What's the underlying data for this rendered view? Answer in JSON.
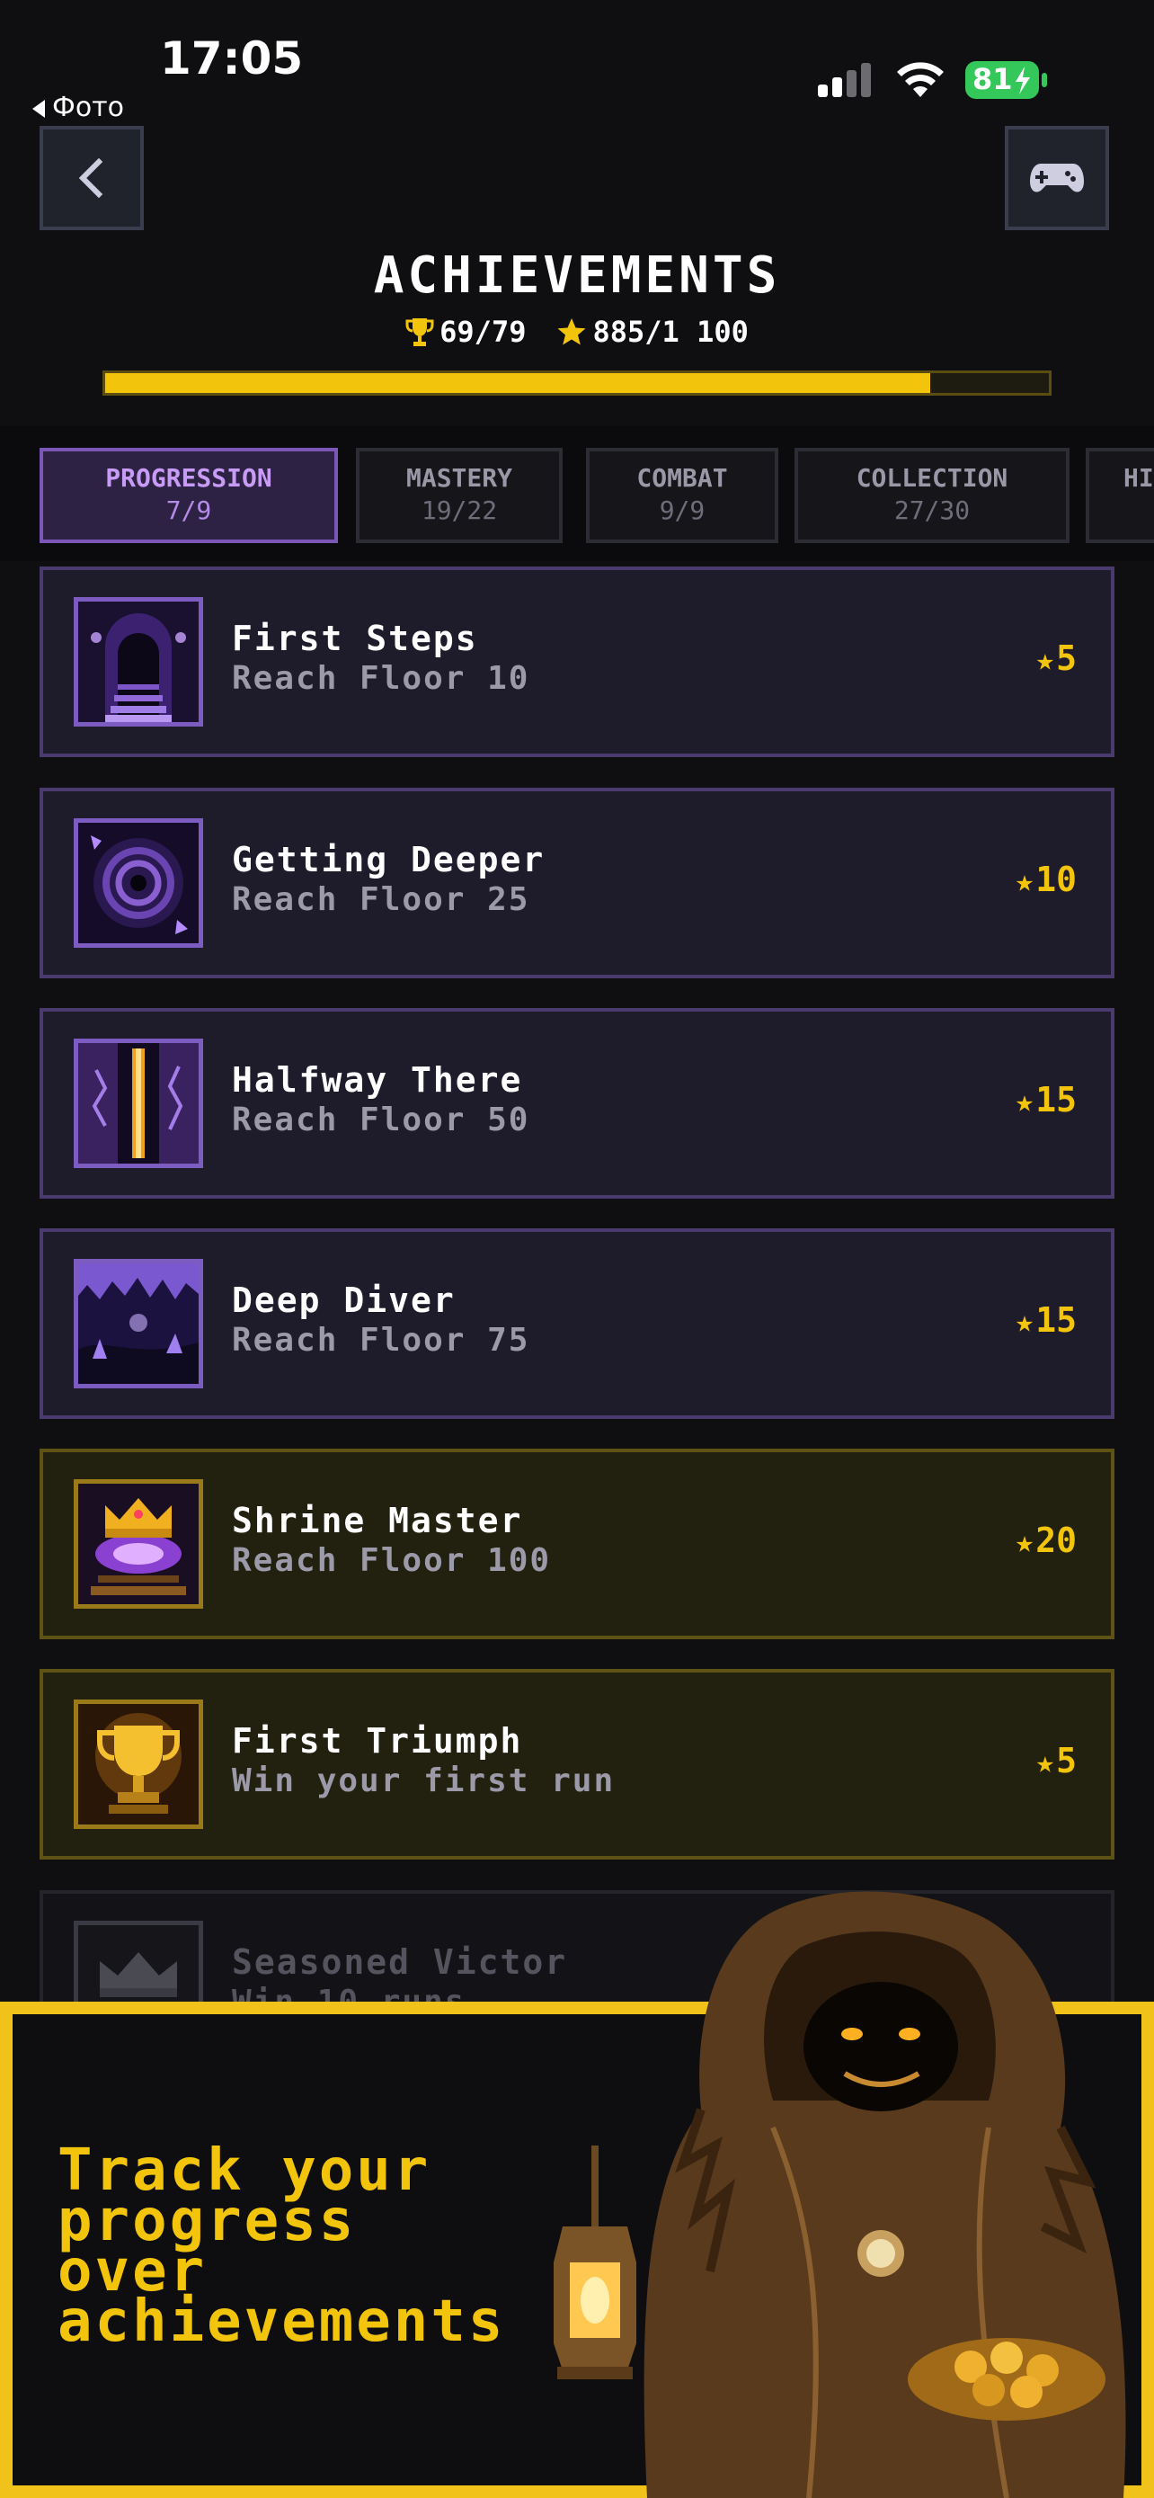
{
  "status_bar": {
    "time": "17:05",
    "back_app": "Фото",
    "battery": "81"
  },
  "header": {
    "title": "ACHIEVEMENTS",
    "trophies": "69/79",
    "stars": "885/1 100",
    "progress_fraction": 0.874
  },
  "tabs": [
    {
      "label": "PROGRESSION",
      "count": "7/9",
      "active": true
    },
    {
      "label": "MASTERY",
      "count": "19/22",
      "active": false
    },
    {
      "label": "COMBAT",
      "count": "9/9",
      "active": false
    },
    {
      "label": "COLLECTION",
      "count": "27/30",
      "active": false
    },
    {
      "label": "HI",
      "count": "",
      "active": false
    }
  ],
  "achievements": [
    {
      "name": "First Steps",
      "desc": "Reach Floor 10",
      "reward": "5",
      "tier": "purple",
      "icon": "dungeon-stairs-icon"
    },
    {
      "name": "Getting Deeper",
      "desc": "Reach Floor 25",
      "reward": "10",
      "tier": "purple",
      "icon": "spiral-vortex-icon"
    },
    {
      "name": "Halfway There",
      "desc": "Reach Floor 50",
      "reward": "15",
      "tier": "purple",
      "icon": "glowing-portal-icon"
    },
    {
      "name": "Deep Diver",
      "desc": "Reach Floor 75",
      "reward": "15",
      "tier": "purple",
      "icon": "crystal-cavern-icon"
    },
    {
      "name": "Shrine Master",
      "desc": "Reach Floor 100",
      "reward": "20",
      "tier": "gold",
      "icon": "crown-shrine-icon"
    },
    {
      "name": "First Triumph",
      "desc": "Win your first run",
      "reward": "5",
      "tier": "gold",
      "icon": "trophy-icon"
    },
    {
      "name": "Seasoned Victor",
      "desc": "Win 10 runs",
      "reward": "",
      "tier": "locked",
      "icon": "locked-crown-icon"
    }
  ],
  "promo": {
    "lines": [
      "Track your",
      "progress",
      "over",
      "achievements"
    ]
  },
  "colors": {
    "accent_gold": "#f2c40c",
    "accent_purple": "#7b57b8",
    "background": "#0f0f12"
  }
}
